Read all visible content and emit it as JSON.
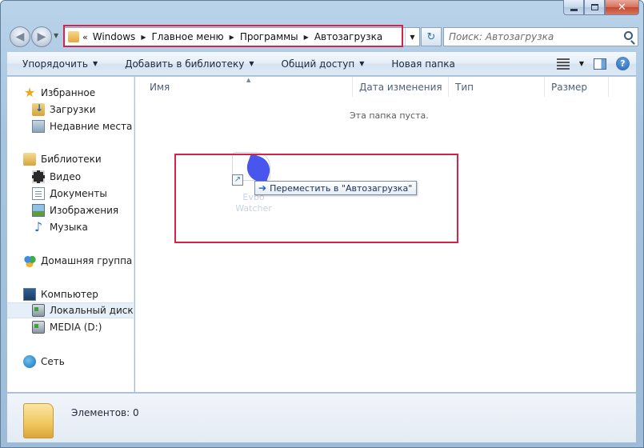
{
  "window": {
    "caption_min": "",
    "caption_max": "",
    "caption_close": "✕"
  },
  "nav": {
    "back_glyph": "◀",
    "fwd_glyph": "▶"
  },
  "address": {
    "prefix": "«",
    "crumbs": [
      "Windows",
      "Главное меню",
      "Программы",
      "Автозагрузка"
    ],
    "separator": "▶",
    "dropdown": "▼",
    "refresh": "↻"
  },
  "search": {
    "placeholder": "Поиск: Автозагрузка"
  },
  "toolbar": {
    "organize": "Упорядочить",
    "add_to_library": "Добавить в библиотеку",
    "share": "Общий доступ",
    "new_folder": "Новая папка",
    "dropdown_arrow": "▼",
    "help": "?"
  },
  "navpane": {
    "favorites": "Избранное",
    "downloads": "Загрузки",
    "recent_places": "Недавние места",
    "libraries": "Библиотеки",
    "video": "Видео",
    "documents": "Документы",
    "images": "Изображения",
    "music": "Музыка",
    "homegroup": "Домашняя группа",
    "computer": "Компьютер",
    "local_disk": "Локальный диск (C",
    "media_disk": "MEDIA (D:)",
    "network": "Сеть"
  },
  "columns": {
    "name": "Имя",
    "date_modified": "Дата изменения",
    "type": "Тип",
    "size": "Размер"
  },
  "content": {
    "empty_message": "Эта папка пуста."
  },
  "drag": {
    "tooltip": "Переместить в \"Автозагрузка\"",
    "tip_arrow": "➔",
    "ghost_label_line1": "Evbo",
    "ghost_label_line2": "Watcher",
    "shortcut_glyph": "↗"
  },
  "details": {
    "items_count": "Элементов: 0"
  },
  "colors": {
    "annotation": "#d6234a",
    "accent": "#1f5fae"
  }
}
